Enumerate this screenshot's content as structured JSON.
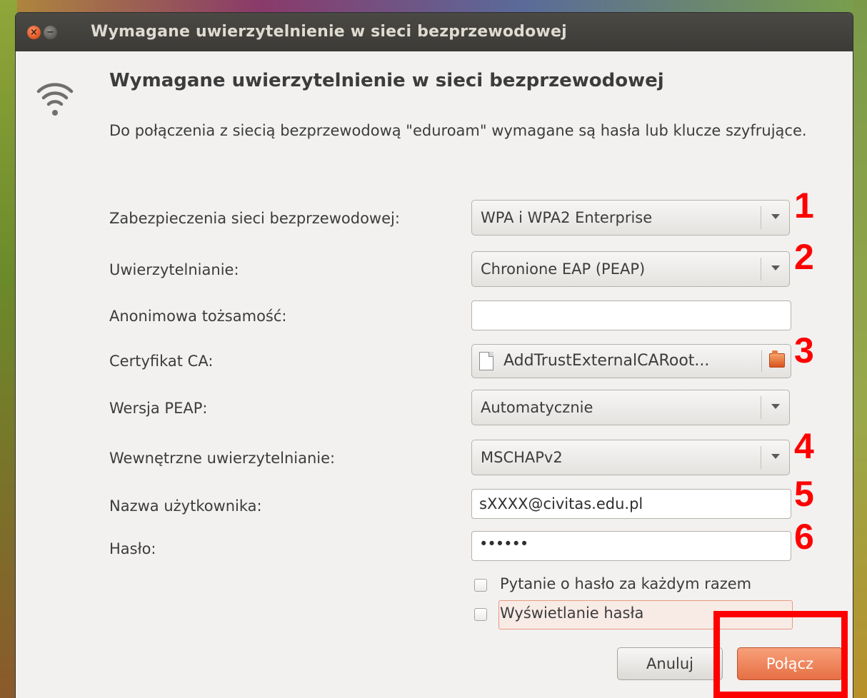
{
  "window": {
    "title": "Wymagane uwierzytelnienie w sieci bezprzewodowej",
    "close_glyph": "×",
    "min_glyph": "−"
  },
  "dialog": {
    "heading": "Wymagane uwierzytelnienie w sieci bezprzewodowej",
    "description": "Do połączenia z siecią bezprzewodową \"eduroam\" wymagane są hasła lub klucze szyfrujące.",
    "icon": "wifi-icon"
  },
  "form": {
    "security": {
      "label": "Zabezpieczenia sieci bezprzewodowej:",
      "value": "WPA i WPA2 Enterprise"
    },
    "auth": {
      "label": "Uwierzytelnianie:",
      "value": "Chronione EAP (PEAP)"
    },
    "anonymous": {
      "label": "Anonimowa tożsamość:",
      "value": ""
    },
    "ca_cert": {
      "label": "Certyfikat CA:",
      "value": "AddTrustExternalCARoot..."
    },
    "peap_version": {
      "label": "Wersja PEAP:",
      "value": "Automatycznie"
    },
    "inner_auth": {
      "label": "Wewnętrzne uwierzytelnianie:",
      "value": "MSCHAPv2"
    },
    "username": {
      "label": "Nazwa użytkownika:",
      "value": "sXXXX@civitas.edu.pl"
    },
    "password": {
      "label": "Hasło:",
      "value": "••••••"
    },
    "ask_password": {
      "label": "Pytanie o hasło za każdym razem",
      "checked": false
    },
    "show_password": {
      "label": "Wyświetlanie hasła",
      "checked": false
    }
  },
  "buttons": {
    "cancel": "Anuluj",
    "connect": "Połącz"
  },
  "annotations": [
    "1",
    "2",
    "3",
    "4",
    "5",
    "6"
  ],
  "colors": {
    "accent": "#e76f44",
    "annotation": "#ff0000",
    "titlebar": "#3c3b37"
  }
}
